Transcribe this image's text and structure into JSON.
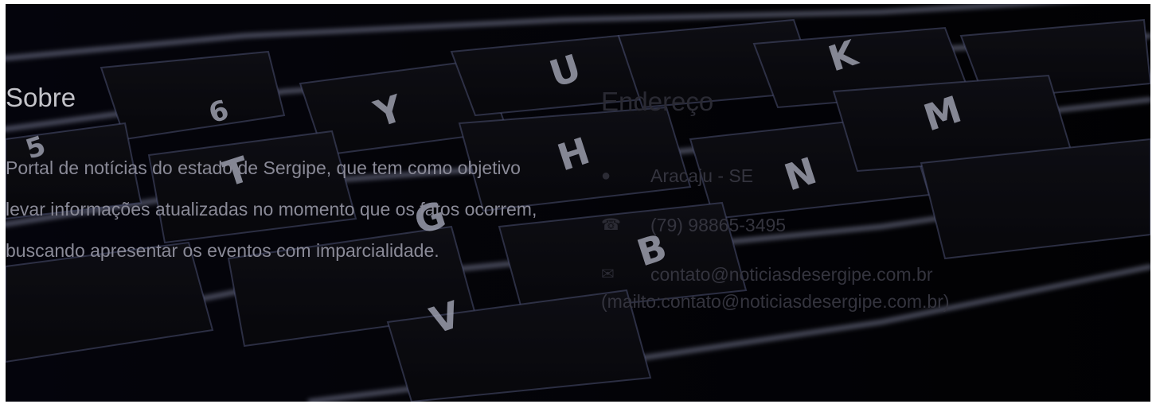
{
  "about": {
    "title": "Sobre",
    "text": "Portal de notícias do estado de Sergipe, que tem como objetivo levar informações atualizadas no momento que os fatos ocorrem, buscando apresentar os eventos com imparcialidade."
  },
  "contact": {
    "title": "Endereço",
    "address": "Aracaju - SE",
    "phone": "(79) 98865-3495",
    "email": "contato@noticiasdesergipe.com.br",
    "mailto": "(mailto:contato@noticiasdesergipe.com.br)",
    "icons": [
      "location-icon",
      "phone-icon",
      "envelope-icon"
    ]
  },
  "colors": {
    "background": "#05050b",
    "key_glow": "#dfe3ff",
    "heading_text": "#c3c3c9",
    "body_text": "#8a8a97"
  }
}
